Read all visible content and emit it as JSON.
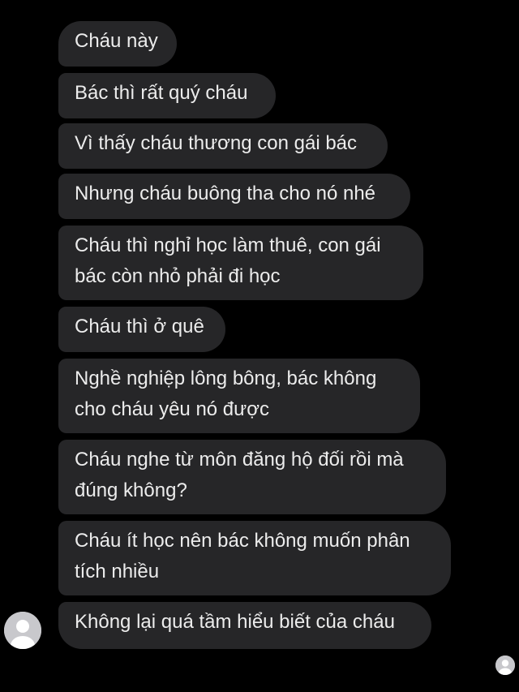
{
  "colors": {
    "background": "#000000",
    "bubble": "#262628",
    "text": "#ECECEC",
    "avatar_bg": "#C8C8CC",
    "avatar_fg": "#FFFFFF"
  },
  "messages": [
    "Cháu này",
    "Bác thì rất quý cháu",
    "Vì thấy cháu thương con gái bác",
    "Nhưng cháu buông tha cho nó nhé",
    "Cháu thì nghỉ học làm thuê, con gái bác còn nhỏ phải đi học",
    "Cháu thì ở quê",
    "Nghề nghiệp lông bông, bác không cho cháu yêu nó được",
    "Cháu nghe từ môn đăng hộ đối rồi mà đúng không?",
    "Cháu ít học nên bác không muốn phân tích nhiều",
    "Không lại quá tầm hiểu biết của cháu"
  ],
  "lines": [
    [
      "Cháu này"
    ],
    [
      "Bác thì rất quý cháu"
    ],
    [
      "Vì thấy cháu thương con gái bác"
    ],
    [
      "Nhưng cháu buông tha cho nó nhé"
    ],
    [
      "Cháu thì nghỉ học làm thuê, con gái",
      "bác còn nhỏ phải đi học"
    ],
    [
      "Cháu thì ở quê"
    ],
    [
      "Nghề nghiệp lông bông, bác không",
      "cho cháu yêu nó được"
    ],
    [
      "Cháu nghe từ môn đăng hộ đối rồi mà",
      "đúng không?"
    ],
    [
      "Cháu ít học nên bác không muốn phân",
      "tích nhiều"
    ],
    [
      "Không lại quá tầm hiểu biết của cháu"
    ]
  ],
  "sender_avatar_icon": "default-user-avatar-icon",
  "read_receipt_icon": "seen-avatar-icon"
}
